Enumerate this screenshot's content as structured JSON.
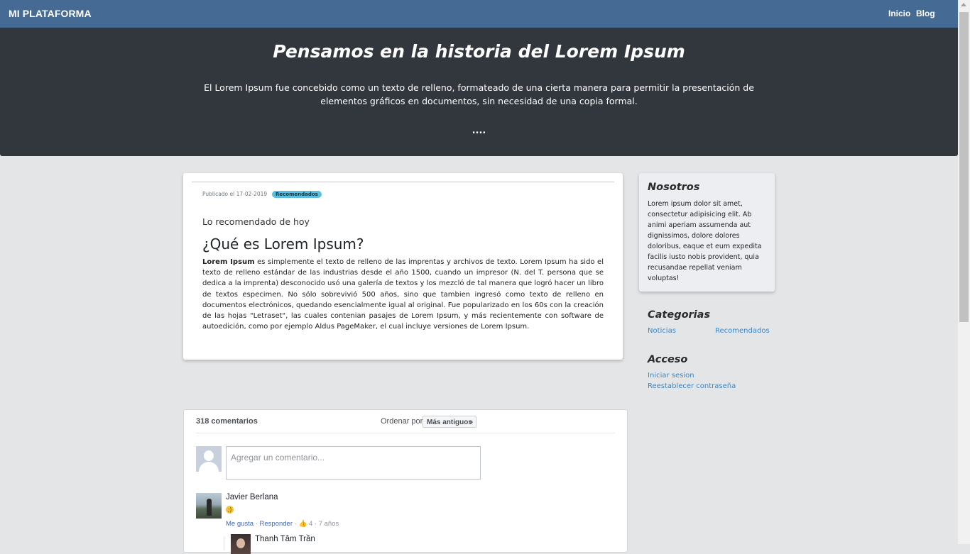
{
  "navbar": {
    "brand": "MI PLATAFORMA",
    "links": [
      "Inicio",
      "Blog"
    ],
    "background": "#456a93"
  },
  "hero": {
    "title": "Pensamos en la historia del Lorem Ipsum",
    "text": "El Lorem Ipsum fue concebido como un texto de relleno, formateado de una cierta manera para permitir la presentación de elementos gráficos en documentos, sin necesidad de una copia formal.",
    "more": "....",
    "background": "#32363d"
  },
  "post": {
    "date": "Publicado el 17-02-2019",
    "badge": "Recomendados",
    "subtitle": "Lo recomendado de hoy",
    "title": "¿Qué es Lorem Ipsum?",
    "lead": "Lorem Ipsum",
    "body": " es simplemente el texto de relleno de las imprentas y archivos de texto. Lorem Ipsum ha sido el texto de relleno estándar de las industrias desde el año 1500, cuando un impresor (N. del T. persona que se dedica a la imprenta) desconocido usó una galería de textos y los mezcló de tal manera que logró hacer un libro de textos especimen. No sólo sobrevivió 500 años, sino que tambien ingresó como texto de relleno en documentos electrónicos, quedando esencialmente igual al original. Fue popularizado en los 60s con la creación de las hojas \"Letraset\", las cuales contenian pasajes de Lorem Ipsum, y más recientemente con software de autoedición, como por ejemplo Aldus PageMaker, el cual incluye versiones de Lorem Ipsum."
  },
  "sidebar": {
    "about": {
      "heading": "Nosotros",
      "text": "Lorem ipsum dolor sit amet, consectetur adipisicing elit. Ab animi aperiam assumenda aut dignissimos, dolore dolores doloribus, eaque et eum expedita facilis iusto nobis provident, quia recusandae repellat veniam voluptas!"
    },
    "categories": {
      "heading": "Categorias",
      "items": [
        "Noticias",
        "Recomendados"
      ]
    },
    "access": {
      "heading": "Acceso",
      "items": [
        "Iniciar sesion",
        "Reestablecer contraseña"
      ]
    }
  },
  "comments": {
    "count": "318 comentarios",
    "sort_label": "Ordenar por",
    "sort_value": "Más antiguos",
    "input_placeholder": "Agregar un comentario...",
    "items": [
      {
        "author": "Javier Berlana",
        "emoji": "😉",
        "like": "Me gusta",
        "reply": "Responder",
        "likes": "4",
        "age": "7 años"
      }
    ],
    "reply_author": "Thanh Tâm Trần"
  }
}
